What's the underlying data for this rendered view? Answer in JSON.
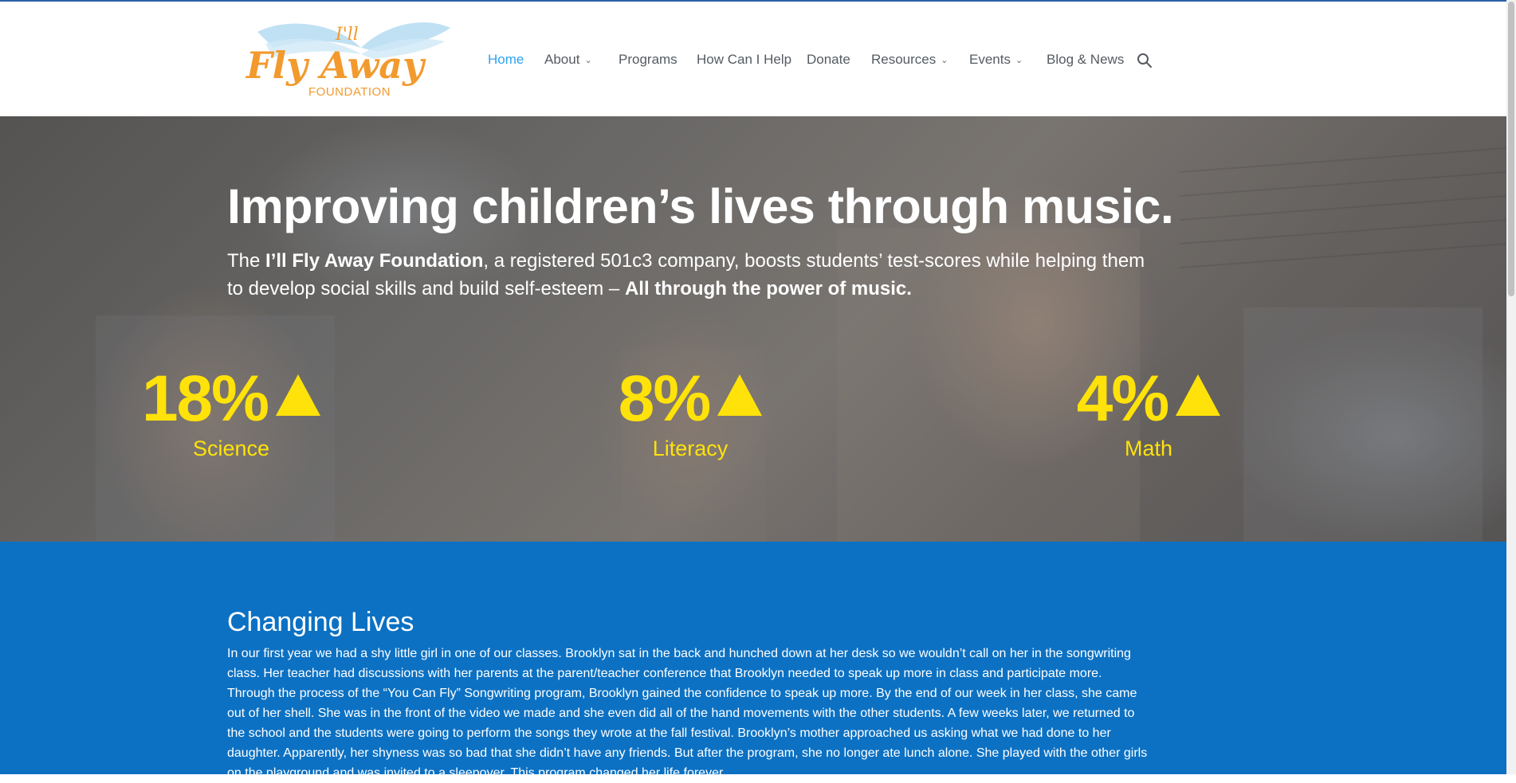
{
  "brand": {
    "logo_top": "I'll",
    "logo_main": "Fly Away",
    "logo_sub": "FOUNDATION",
    "colors": {
      "logo_orange": "#f29a2e",
      "wing_blue": "#a9d6ee",
      "active_nav": "#2ea3f2",
      "accent_yellow": "#ffe20a",
      "section_blue": "#0c71c3"
    }
  },
  "nav": {
    "items": [
      {
        "label": "Home",
        "active": true,
        "dropdown": false
      },
      {
        "label": "About",
        "dropdown": true
      },
      {
        "label": "Programs",
        "dropdown": false
      },
      {
        "label": "How Can I Help",
        "dropdown": false
      },
      {
        "label": "Donate",
        "dropdown": false
      },
      {
        "label": "Resources",
        "dropdown": true
      },
      {
        "label": "Events",
        "dropdown": true
      },
      {
        "label": "Blog & News",
        "dropdown": false
      }
    ],
    "caret": "⌄",
    "search_icon": "search-icon"
  },
  "hero": {
    "title": "Improving children’s lives through music.",
    "sub_pre": "The ",
    "sub_bold": "I’ll Fly Away Foundation",
    "sub_mid": ", a registered 501c3 company, boosts students’ test-scores while helping them to develop social skills and build self-esteem – ",
    "sub_bold2": "All through the power of music.",
    "stats": [
      {
        "value": "18%",
        "label": "Science"
      },
      {
        "value": "8%",
        "label": "Literacy"
      },
      {
        "value": "4%",
        "label": "Math"
      }
    ]
  },
  "section": {
    "title": "Changing Lives",
    "body": "In our first year we had a shy little girl in one of our classes. Brooklyn sat in the back and hunched down at her desk so we wouldn’t call on her in the songwriting class. Her teacher had discussions with her parents at the parent/teacher conference that Brooklyn needed to speak up more in class and participate more. Through the process of the “You Can Fly” Songwriting program, Brooklyn gained the confidence to speak up more. By the end of our week in her class, she came out of her shell. She was in the front of the video we made and she even did all of the hand movements with the other students. A few weeks later, we returned to the school and the students were going to perform the songs they wrote at the fall festival. Brooklyn’s mother approached us asking what we had done to her daughter. Apparently, her shyness was so bad that she didn’t have any friends. But after the program, she no longer ate lunch alone. She played with the other girls on the playground and was invited to a sleepover. This program changed her life forever."
  }
}
